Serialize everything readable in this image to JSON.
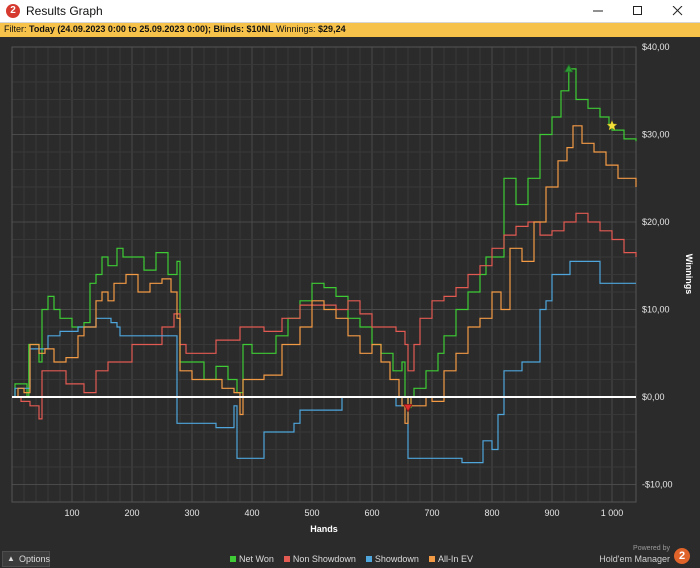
{
  "window": {
    "title": "Results Graph",
    "app_icon": "2",
    "controls": [
      "minimize-icon",
      "maximize-icon",
      "close-icon"
    ]
  },
  "filter": {
    "prefix": "Filter:",
    "date_label": "Today (24.09.2023 0:00 to 25.09.2023 0:00);",
    "blinds_label": "Blinds: $10NL",
    "winnings_label": "Winnings:",
    "winnings_value": "$29,24",
    "bar_color": "#f6c24a"
  },
  "chart_data": {
    "type": "line",
    "xlabel": "Hands",
    "ylabel": "Winnings",
    "xlim": [
      0,
      1040
    ],
    "ylim": [
      -12,
      40
    ],
    "x_ticks": [
      100,
      200,
      300,
      400,
      500,
      600,
      700,
      800,
      900,
      1000
    ],
    "x_tick_labels": [
      "100",
      "200",
      "300",
      "400",
      "500",
      "600",
      "700",
      "800",
      "900",
      "1 000"
    ],
    "y_ticks": [
      -10,
      0,
      10,
      20,
      30,
      40
    ],
    "y_tick_labels": [
      "-$10,00",
      "$0,00",
      "$10,00",
      "$20,00",
      "$30,00",
      "$40,00"
    ],
    "zero_line": true,
    "grid": true,
    "legend_position": "bottom-center",
    "series": [
      {
        "name": "Net Won",
        "color": "#3ecb35",
        "points": [
          [
            0,
            0
          ],
          [
            5,
            1.5
          ],
          [
            15,
            1.5
          ],
          [
            25,
            0
          ],
          [
            28,
            6
          ],
          [
            40,
            6
          ],
          [
            45,
            4
          ],
          [
            50,
            10
          ],
          [
            60,
            11.5
          ],
          [
            70,
            10
          ],
          [
            80,
            9
          ],
          [
            100,
            8
          ],
          [
            120,
            8.5
          ],
          [
            130,
            13
          ],
          [
            140,
            14
          ],
          [
            150,
            16
          ],
          [
            160,
            15
          ],
          [
            175,
            17
          ],
          [
            185,
            16
          ],
          [
            200,
            16
          ],
          [
            220,
            14.5
          ],
          [
            240,
            16.5
          ],
          [
            260,
            14
          ],
          [
            275,
            15.5
          ],
          [
            280,
            4
          ],
          [
            290,
            4
          ],
          [
            300,
            4
          ],
          [
            320,
            2
          ],
          [
            340,
            3.5
          ],
          [
            360,
            2
          ],
          [
            375,
            0.5
          ],
          [
            385,
            6
          ],
          [
            400,
            5
          ],
          [
            420,
            5
          ],
          [
            440,
            7
          ],
          [
            460,
            9
          ],
          [
            480,
            11
          ],
          [
            500,
            13
          ],
          [
            520,
            12.5
          ],
          [
            540,
            11.5
          ],
          [
            560,
            9
          ],
          [
            580,
            8
          ],
          [
            600,
            6
          ],
          [
            615,
            5
          ],
          [
            635,
            3
          ],
          [
            650,
            4
          ],
          [
            655,
            0
          ],
          [
            660,
            -1.2
          ],
          [
            665,
            0
          ],
          [
            670,
            1
          ],
          [
            690,
            3
          ],
          [
            710,
            5
          ],
          [
            720,
            7
          ],
          [
            740,
            10
          ],
          [
            760,
            12
          ],
          [
            780,
            14
          ],
          [
            790,
            16
          ],
          [
            800,
            16
          ],
          [
            820,
            25
          ],
          [
            840,
            22
          ],
          [
            860,
            25
          ],
          [
            880,
            30
          ],
          [
            900,
            32
          ],
          [
            915,
            35
          ],
          [
            928,
            37.5
          ],
          [
            940,
            34
          ],
          [
            960,
            33
          ],
          [
            980,
            32
          ],
          [
            995,
            31
          ],
          [
            1000,
            30.5
          ],
          [
            1020,
            29.5
          ],
          [
            1040,
            29.24
          ]
        ]
      },
      {
        "name": "Non Showdown",
        "color": "#e25a52",
        "points": [
          [
            0,
            0
          ],
          [
            15,
            -0.5
          ],
          [
            30,
            -1
          ],
          [
            45,
            -2.5
          ],
          [
            50,
            3
          ],
          [
            70,
            3
          ],
          [
            90,
            1.5
          ],
          [
            120,
            0.5
          ],
          [
            140,
            3
          ],
          [
            160,
            4
          ],
          [
            200,
            6
          ],
          [
            230,
            6
          ],
          [
            250,
            8
          ],
          [
            270,
            9.5
          ],
          [
            280,
            6
          ],
          [
            290,
            5
          ],
          [
            300,
            5
          ],
          [
            340,
            6.5
          ],
          [
            380,
            8
          ],
          [
            420,
            7.5
          ],
          [
            450,
            9
          ],
          [
            480,
            10.5
          ],
          [
            510,
            10.5
          ],
          [
            540,
            10
          ],
          [
            560,
            11
          ],
          [
            580,
            9.5
          ],
          [
            600,
            8
          ],
          [
            640,
            7.5
          ],
          [
            655,
            6
          ],
          [
            660,
            3
          ],
          [
            670,
            6
          ],
          [
            680,
            9
          ],
          [
            700,
            11
          ],
          [
            720,
            11.5
          ],
          [
            740,
            12.5
          ],
          [
            760,
            14
          ],
          [
            780,
            15
          ],
          [
            800,
            17
          ],
          [
            820,
            18.5
          ],
          [
            840,
            19.5
          ],
          [
            860,
            20
          ],
          [
            880,
            18.5
          ],
          [
            900,
            19
          ],
          [
            920,
            20
          ],
          [
            940,
            21
          ],
          [
            960,
            20
          ],
          [
            980,
            19
          ],
          [
            1000,
            18
          ],
          [
            1020,
            16.5
          ],
          [
            1040,
            16
          ]
        ]
      },
      {
        "name": "Showdown",
        "color": "#4ea6dc",
        "points": [
          [
            0,
            0
          ],
          [
            5,
            1
          ],
          [
            20,
            1
          ],
          [
            30,
            5.5
          ],
          [
            55,
            5.5
          ],
          [
            60,
            7
          ],
          [
            80,
            7.5
          ],
          [
            110,
            8
          ],
          [
            140,
            9
          ],
          [
            165,
            8.5
          ],
          [
            175,
            8
          ],
          [
            180,
            7
          ],
          [
            240,
            7
          ],
          [
            270,
            7
          ],
          [
            275,
            -3
          ],
          [
            320,
            -3
          ],
          [
            340,
            -3.5
          ],
          [
            370,
            -1
          ],
          [
            375,
            -7
          ],
          [
            400,
            -7
          ],
          [
            420,
            -4
          ],
          [
            460,
            -4
          ],
          [
            470,
            -3
          ],
          [
            480,
            -1.5
          ],
          [
            520,
            -1.5
          ],
          [
            550,
            0
          ],
          [
            630,
            0
          ],
          [
            640,
            -1
          ],
          [
            650,
            0
          ],
          [
            660,
            -7
          ],
          [
            690,
            -7
          ],
          [
            720,
            -7
          ],
          [
            750,
            -7.5
          ],
          [
            780,
            -7.5
          ],
          [
            785,
            -5
          ],
          [
            800,
            -6
          ],
          [
            810,
            -2
          ],
          [
            820,
            3
          ],
          [
            850,
            4
          ],
          [
            880,
            10
          ],
          [
            890,
            11
          ],
          [
            900,
            14
          ],
          [
            915,
            14
          ],
          [
            930,
            15.5
          ],
          [
            960,
            15.5
          ],
          [
            980,
            13
          ],
          [
            1000,
            13
          ],
          [
            1040,
            13
          ]
        ]
      },
      {
        "name": "All-In EV",
        "color": "#f39a45",
        "points": [
          [
            0,
            0
          ],
          [
            10,
            1
          ],
          [
            20,
            0.5
          ],
          [
            30,
            6
          ],
          [
            45,
            5
          ],
          [
            55,
            5.5
          ],
          [
            70,
            4
          ],
          [
            90,
            4.5
          ],
          [
            110,
            7
          ],
          [
            120,
            8
          ],
          [
            140,
            11
          ],
          [
            150,
            12
          ],
          [
            160,
            11
          ],
          [
            170,
            13
          ],
          [
            190,
            14
          ],
          [
            210,
            12
          ],
          [
            230,
            13
          ],
          [
            250,
            13.5
          ],
          [
            265,
            12
          ],
          [
            275,
            9
          ],
          [
            280,
            3
          ],
          [
            300,
            2
          ],
          [
            330,
            2
          ],
          [
            350,
            1
          ],
          [
            370,
            0.5
          ],
          [
            380,
            -2
          ],
          [
            385,
            2
          ],
          [
            400,
            2
          ],
          [
            420,
            2.5
          ],
          [
            450,
            6
          ],
          [
            480,
            8
          ],
          [
            500,
            11
          ],
          [
            520,
            10
          ],
          [
            540,
            9
          ],
          [
            560,
            7
          ],
          [
            580,
            5
          ],
          [
            600,
            6
          ],
          [
            615,
            4
          ],
          [
            630,
            2
          ],
          [
            645,
            0
          ],
          [
            650,
            -1
          ],
          [
            655,
            -3
          ],
          [
            660,
            0
          ],
          [
            665,
            -1
          ],
          [
            690,
            0
          ],
          [
            700,
            -0.5
          ],
          [
            720,
            3
          ],
          [
            740,
            5
          ],
          [
            760,
            8
          ],
          [
            780,
            9
          ],
          [
            800,
            12
          ],
          [
            815,
            10
          ],
          [
            830,
            17
          ],
          [
            850,
            15.5
          ],
          [
            870,
            20
          ],
          [
            890,
            24
          ],
          [
            910,
            27
          ],
          [
            925,
            28.5
          ],
          [
            935,
            31
          ],
          [
            950,
            29
          ],
          [
            970,
            28
          ],
          [
            990,
            26.5
          ],
          [
            1010,
            25
          ],
          [
            1040,
            24
          ]
        ]
      }
    ],
    "markers": [
      {
        "label": "peak",
        "shape": "triangle-up",
        "color": "#2f9a35",
        "x": 928,
        "y": 37.5
      },
      {
        "label": "trough",
        "shape": "triangle-down",
        "color": "#e02d2d",
        "x": 660,
        "y": -1.2
      },
      {
        "label": "current",
        "shape": "star",
        "color": "#f4e23c",
        "x": 1000,
        "y": 31
      }
    ]
  },
  "footer": {
    "options_label": "Options",
    "legend": [
      {
        "label": "Net Won",
        "color": "#3ecb35"
      },
      {
        "label": "Non Showdown",
        "color": "#e25a52"
      },
      {
        "label": "Showdown",
        "color": "#4ea6dc"
      },
      {
        "label": "All-In EV",
        "color": "#f39a45"
      }
    ],
    "powered_by": "Powered by",
    "brand_name": "Hold'em Manager",
    "brand_logo": "2"
  }
}
